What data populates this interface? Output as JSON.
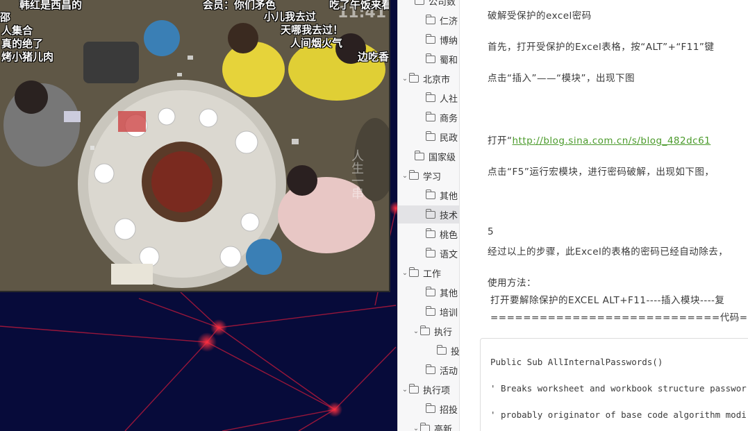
{
  "video": {
    "clock": "11:41",
    "vertical_text": "人生一串",
    "danmaku": [
      {
        "text": "韩红是西昌的"
      },
      {
        "text": "会员：你们矛色"
      },
      {
        "text": "吃了午饭来看"
      },
      {
        "text": "小儿我去过"
      },
      {
        "text": "天哪我去过！"
      },
      {
        "text": "人间烟火气"
      },
      {
        "text": "边吃香"
      },
      {
        "text": "邵"
      },
      {
        "text": "人集合"
      },
      {
        "text": "真的绝了"
      },
      {
        "text": "烤小猪儿肉"
      }
    ]
  },
  "tree": {
    "items": [
      {
        "label": "公司数",
        "chevron": "",
        "selected": false
      },
      {
        "label": "仁济",
        "chevron": "",
        "selected": false
      },
      {
        "label": "博纳",
        "chevron": "",
        "selected": false
      },
      {
        "label": "蜀和",
        "chevron": "",
        "selected": false
      },
      {
        "label": "北京市",
        "chevron": "v",
        "selected": false
      },
      {
        "label": "人社",
        "chevron": "",
        "selected": false
      },
      {
        "label": "商务",
        "chevron": "",
        "selected": false
      },
      {
        "label": "民政",
        "chevron": "",
        "selected": false
      },
      {
        "label": "国家级",
        "chevron": "",
        "selected": false
      },
      {
        "label": "学习",
        "chevron": "v",
        "selected": false
      },
      {
        "label": "其他",
        "chevron": "",
        "selected": false
      },
      {
        "label": "技术",
        "chevron": "",
        "selected": true
      },
      {
        "label": "桃色",
        "chevron": "",
        "selected": false
      },
      {
        "label": "语文",
        "chevron": "",
        "selected": false
      },
      {
        "label": "工作",
        "chevron": "v",
        "selected": false
      },
      {
        "label": "其他",
        "chevron": "",
        "selected": false
      },
      {
        "label": "培训",
        "chevron": "",
        "selected": false
      },
      {
        "label": "执行",
        "chevron": "v",
        "selected": false
      },
      {
        "label": "投",
        "chevron": "",
        "selected": false
      },
      {
        "label": "活动",
        "chevron": "",
        "selected": false
      },
      {
        "label": "执行项",
        "chevron": "v",
        "selected": false
      },
      {
        "label": "招投",
        "chevron": "",
        "selected": false
      },
      {
        "label": "高新",
        "chevron": "v",
        "selected": false
      }
    ]
  },
  "doc": {
    "title": "破解受保护的excel密码",
    "p1": "首先，打开受保护的Excel表格，按“ALT”+“F11”键",
    "p2": "点击“插入”——“模块”，出现下图",
    "p3_prefix": "打开“",
    "p3_link": "http://blog.sina.com.cn/s/blog_482dc61",
    "p4": "点击“F5”运行宏模块，进行密码破解，出现如下图，",
    "step": "5",
    "p5": "经过以上的步骤，此Excel的表格的密码已经自动除去，",
    "usage_title": "使用方法：",
    "usage_1": "打开要解除保护的EXCEL ALT+F11----插入模块----复",
    "usage_2": "============================代码==========",
    "code": [
      "Public Sub AllInternalPasswords()",
      "' Breaks worksheet and workbook structure passwor",
      "' probably originator of base code algorithm modi"
    ]
  }
}
